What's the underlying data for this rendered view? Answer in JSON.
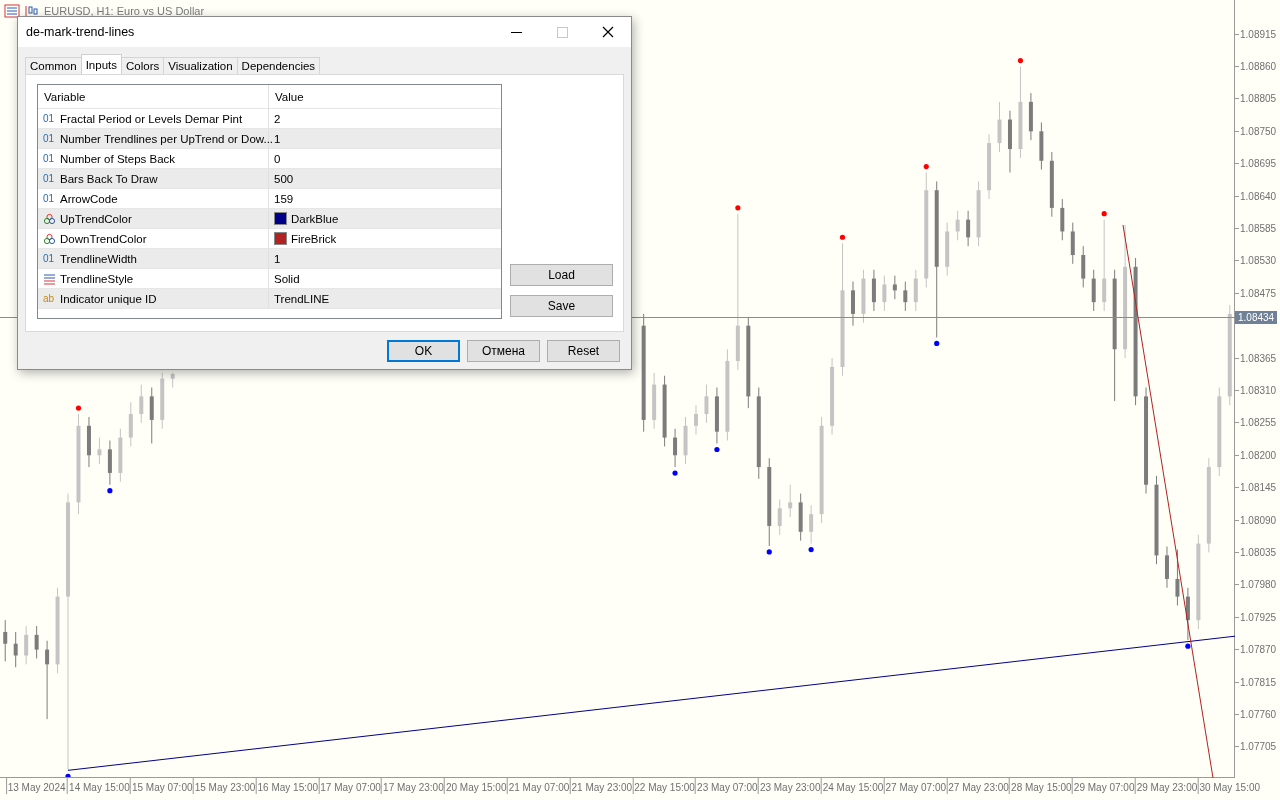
{
  "chart_window": {
    "title": "EURUSD, H1: Euro vs US Dollar",
    "current_price": "1.08434",
    "chart_data": {
      "type": "candlestick",
      "categories": [
        null,
        null,
        null,
        "13 May 2024",
        null,
        null,
        null,
        null,
        null,
        "14 May 15:00",
        null,
        null,
        null,
        null,
        null,
        "15 May 07:00",
        null,
        null,
        null,
        null,
        null,
        "15 May 23:00",
        null,
        null,
        null,
        null,
        null,
        "16 May 15:00",
        null,
        null,
        null,
        null,
        null,
        "17 May 07:00",
        null,
        null,
        null,
        null,
        null,
        "17 May 23:00",
        null,
        null,
        null,
        null,
        null,
        "20 May 15:00",
        null,
        null,
        null,
        null,
        null,
        "21 May 07:00",
        null,
        null,
        null,
        null,
        null,
        "21 May 23:00",
        null,
        null,
        null,
        null,
        null,
        "22 May 15:00",
        null,
        null,
        null,
        null,
        null,
        "23 May 07:00",
        null,
        null,
        null,
        null,
        null,
        "23 May 23:00",
        null,
        null,
        null,
        null,
        null,
        "24 May 15:00",
        null,
        null,
        null,
        null,
        null,
        "27 May 07:00",
        null,
        null,
        null,
        null,
        null,
        "27 May 23:00",
        null,
        null,
        null,
        null,
        null,
        "28 May 15:00",
        null,
        null,
        null,
        null,
        null,
        "29 May 07:00",
        null,
        null,
        null,
        null,
        null,
        "29 May 23:00",
        null,
        null,
        null,
        null,
        null,
        "30 May 15:00"
      ],
      "ohlc": [
        [
          1.079,
          1.0792,
          1.0785,
          1.0788
        ],
        [
          1.0788,
          1.079,
          1.0784,
          1.0786
        ],
        [
          1.0786,
          1.0791,
          1.07845,
          1.07895
        ],
        [
          1.07895,
          1.0791,
          1.07855,
          1.0787
        ],
        [
          1.0787,
          1.07885,
          1.07752,
          1.07845
        ],
        [
          1.07845,
          1.07975,
          1.0783,
          1.0796
        ],
        [
          1.0796,
          1.08135,
          1.07665,
          1.0812
        ],
        [
          1.0812,
          1.0827,
          1.081,
          1.0825
        ],
        [
          1.0825,
          1.08265,
          1.0818,
          1.082
        ],
        [
          1.082,
          1.0823,
          1.08185,
          1.0821
        ],
        [
          1.0821,
          1.08225,
          1.0815,
          1.0817
        ],
        [
          1.0817,
          1.08245,
          1.08155,
          1.0823
        ],
        [
          1.0823,
          1.0829,
          1.08215,
          1.0827
        ],
        [
          1.0827,
          1.0832,
          1.08255,
          1.083
        ],
        [
          1.083,
          1.08315,
          1.0822,
          1.0826
        ],
        [
          1.0826,
          1.0834,
          1.08245,
          1.0833
        ],
        [
          1.0833,
          1.0834,
          1.08315,
          1.08338
        ],
        null,
        null,
        null,
        null,
        null,
        null,
        null,
        null,
        null,
        null,
        null,
        null,
        null,
        null,
        null,
        null,
        null,
        null,
        null,
        null,
        null,
        null,
        null,
        null,
        null,
        null,
        null,
        null,
        null,
        null,
        null,
        null,
        null,
        null,
        null,
        null,
        null,
        null,
        null,
        null,
        null,
        null,
        null,
        null,
        [
          1.0842,
          1.0844,
          1.0824,
          1.0826
        ],
        [
          1.0826,
          1.0834,
          1.08245,
          1.0832
        ],
        [
          1.0832,
          1.08335,
          1.08215,
          1.0823
        ],
        [
          1.0823,
          1.08245,
          1.0818,
          1.082
        ],
        [
          1.082,
          1.08265,
          1.08185,
          1.0825
        ],
        [
          1.0825,
          1.08285,
          1.08235,
          1.0827
        ],
        [
          1.0827,
          1.0832,
          1.08255,
          1.083
        ],
        [
          1.083,
          1.08315,
          1.0822,
          1.0824
        ],
        [
          1.0824,
          1.0838,
          1.08225,
          1.0836
        ],
        [
          1.0836,
          1.0861,
          1.08345,
          1.0842
        ],
        [
          1.0842,
          1.08435,
          1.0828,
          1.083
        ],
        [
          1.083,
          1.08315,
          1.0816,
          1.0818
        ],
        [
          1.0818,
          1.08195,
          1.08046,
          1.0808
        ],
        [
          1.0808,
          1.08125,
          1.08065,
          1.0811
        ],
        [
          1.0811,
          1.0815,
          1.08095,
          1.0812
        ],
        [
          1.0812,
          1.08135,
          1.08055,
          1.0807
        ],
        [
          1.0807,
          1.08115,
          1.0805,
          1.081
        ],
        [
          1.081,
          1.08265,
          1.08085,
          1.0825
        ],
        [
          1.0825,
          1.08365,
          1.08235,
          1.0835
        ],
        [
          1.0835,
          1.0856,
          1.08335,
          1.0848
        ],
        [
          1.0848,
          1.08495,
          1.0842,
          1.0844
        ],
        [
          1.0844,
          1.08515,
          1.08425,
          1.085
        ],
        [
          1.085,
          1.08515,
          1.08445,
          1.0846
        ],
        [
          1.0846,
          1.08505,
          1.08445,
          1.0849
        ],
        [
          1.0849,
          1.08505,
          1.08465,
          1.0848
        ],
        [
          1.0848,
          1.08495,
          1.08445,
          1.0846
        ],
        [
          1.0846,
          1.08515,
          1.08445,
          1.085
        ],
        [
          1.085,
          1.0868,
          1.08485,
          1.0865
        ],
        [
          1.0865,
          1.08665,
          1.084,
          1.0852
        ],
        [
          1.0852,
          1.08595,
          1.08505,
          1.0858
        ],
        [
          1.0858,
          1.08615,
          1.08565,
          1.086
        ],
        [
          1.086,
          1.08615,
          1.08555,
          1.0857
        ],
        [
          1.0857,
          1.08665,
          1.08555,
          1.0865
        ],
        [
          1.0865,
          1.08745,
          1.08635,
          1.0873
        ],
        [
          1.0873,
          1.088,
          1.08715,
          1.0877
        ],
        [
          1.0877,
          1.08785,
          1.0868,
          1.0872
        ],
        [
          1.0872,
          1.0886,
          1.08705,
          1.088
        ],
        [
          1.088,
          1.08815,
          1.08735,
          1.0875
        ],
        [
          1.0875,
          1.08765,
          1.08685,
          1.087
        ],
        [
          1.087,
          1.08715,
          1.08605,
          1.0862
        ],
        [
          1.0862,
          1.08635,
          1.08565,
          1.0858
        ],
        [
          1.0858,
          1.08595,
          1.08525,
          1.0854
        ],
        [
          1.0854,
          1.08555,
          1.08485,
          1.085
        ],
        [
          1.085,
          1.08515,
          1.08445,
          1.0846
        ],
        [
          1.0846,
          1.086,
          1.08445,
          1.085
        ],
        [
          1.085,
          1.08515,
          1.08292,
          1.0838
        ],
        [
          1.0838,
          1.08591,
          1.08365,
          1.0852
        ],
        [
          1.0852,
          1.08535,
          1.08285,
          1.083
        ],
        [
          1.083,
          1.08315,
          1.08135,
          1.0815
        ],
        [
          1.0815,
          1.08165,
          1.08015,
          1.0803
        ],
        [
          1.0803,
          1.08045,
          1.07975,
          1.0799
        ],
        [
          1.0799,
          1.0804,
          1.07945,
          1.0796
        ],
        [
          1.0796,
          1.07975,
          1.07886,
          1.0792
        ],
        [
          1.0792,
          1.08065,
          1.07905,
          1.0805
        ],
        [
          1.0805,
          1.08195,
          1.08035,
          1.0818
        ],
        [
          1.0818,
          1.08315,
          1.08165,
          1.083
        ],
        [
          1.083,
          1.08455,
          1.08285,
          1.0844
        ]
      ],
      "ylim": [
        1.07652,
        1.08973
      ],
      "yticks": [
        {
          "value": 1.08915,
          "label": "1.08915"
        },
        {
          "value": 1.0886,
          "label": "1.08860"
        },
        {
          "value": 1.08805,
          "label": "1.08805"
        },
        {
          "value": 1.0875,
          "label": "1.08750"
        },
        {
          "value": 1.08695,
          "label": "1.08695"
        },
        {
          "value": 1.0864,
          "label": "1.08640"
        },
        {
          "value": 1.08585,
          "label": "1.08585"
        },
        {
          "value": 1.0853,
          "label": "1.08530"
        },
        {
          "value": 1.08475,
          "label": "1.08475"
        },
        {
          "value": 1.08365,
          "label": "1.08365"
        },
        {
          "value": 1.0831,
          "label": "1.08310"
        },
        {
          "value": 1.08255,
          "label": "1.08255"
        },
        {
          "value": 1.082,
          "label": "1.08200"
        },
        {
          "value": 1.08145,
          "label": "1.08145"
        },
        {
          "value": 1.0809,
          "label": "1.08090"
        },
        {
          "value": 1.08035,
          "label": "1.08035"
        },
        {
          "value": 1.0798,
          "label": "1.07980"
        },
        {
          "value": 1.07925,
          "label": "1.07925"
        },
        {
          "value": 1.0787,
          "label": "1.07870"
        },
        {
          "value": 1.07815,
          "label": "1.07815"
        },
        {
          "value": 1.0776,
          "label": "1.07760"
        },
        {
          "value": 1.07705,
          "label": "1.07705"
        }
      ]
    }
  },
  "dialog": {
    "title": "de-mark-trend-lines",
    "tabs": [
      {
        "label": "Common",
        "selected": false
      },
      {
        "label": "Inputs",
        "selected": true
      },
      {
        "label": "Colors",
        "selected": false
      },
      {
        "label": "Visualization",
        "selected": false
      },
      {
        "label": "Dependencies",
        "selected": false
      }
    ],
    "table": {
      "columns": [
        "Variable",
        "Value"
      ],
      "rows": [
        {
          "kind": "int",
          "icon": "01",
          "variable": "Fractal Period or Levels Demar Pint",
          "value": "2"
        },
        {
          "kind": "int",
          "icon": "01",
          "variable": "Number  Trendlines per UpTrend or Dow...",
          "value": "1"
        },
        {
          "kind": "int",
          "icon": "01",
          "variable": "Number of Steps Back",
          "value": "0"
        },
        {
          "kind": "int",
          "icon": "01",
          "variable": "Bars Back To Draw",
          "value": "500"
        },
        {
          "kind": "int",
          "icon": "01",
          "variable": "ArrowCode",
          "value": "159"
        },
        {
          "kind": "color",
          "variable": "UpTrendColor",
          "value": "DarkBlue",
          "color": "#00008b"
        },
        {
          "kind": "color",
          "variable": "DownTrendColor",
          "value": "FireBrick",
          "color": "#b22222"
        },
        {
          "kind": "int",
          "icon": "01",
          "variable": "TrendlineWidth",
          "value": "1"
        },
        {
          "kind": "enum",
          "variable": "TrendlineStyle",
          "value": "Solid"
        },
        {
          "kind": "string",
          "icon": "ab",
          "variable": "Indicator unique ID",
          "value": "TrendLINE"
        }
      ]
    },
    "side_buttons": [
      "Load",
      "Save"
    ],
    "buttons": [
      {
        "label": "OK",
        "default": true
      },
      {
        "label": "Отмена",
        "default": false
      },
      {
        "label": "Reset",
        "default": false
      }
    ]
  }
}
